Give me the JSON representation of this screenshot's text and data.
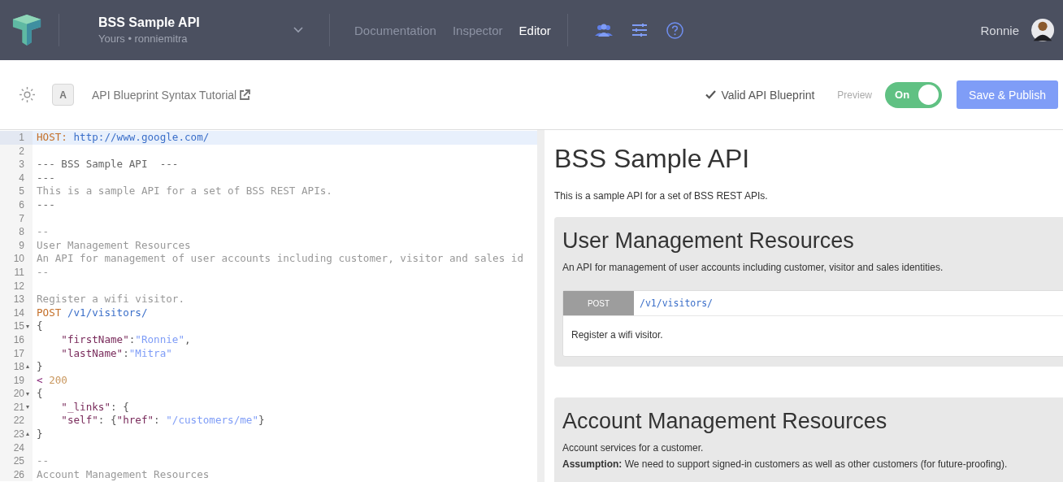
{
  "header": {
    "project_title": "BSS Sample API",
    "project_owner": "Yours • ronniemitra",
    "nav": [
      {
        "label": "Documentation",
        "selected": false
      },
      {
        "label": "Inspector",
        "selected": false
      },
      {
        "label": "Editor",
        "selected": true
      }
    ],
    "user_name": "Ronnie"
  },
  "toolbar": {
    "font_button": "A",
    "tutorial_link": "API Blueprint Syntax Tutorial",
    "validation": "Valid API Blueprint",
    "preview_label": "Preview",
    "preview_toggle": {
      "label": "On",
      "on": true
    },
    "save_button": "Save & Publish"
  },
  "editor": {
    "lines": [
      {
        "number": "1",
        "active": true,
        "tokens": [
          {
            "kind": "keyword",
            "text": "HOST: "
          },
          {
            "kind": "url",
            "text": "http://www.google.com/"
          }
        ]
      },
      {
        "number": "2",
        "active": false
      },
      {
        "number": "3",
        "active": false,
        "tokens": [
          {
            "kind": "heading",
            "text": "--- BSS Sample API  ---"
          }
        ]
      },
      {
        "number": "4",
        "active": false,
        "tokens": [
          {
            "kind": "heading",
            "text": "---"
          }
        ]
      },
      {
        "number": "5",
        "active": false,
        "tokens": [
          {
            "kind": "comment",
            "text": "This is a sample API for a set of BSS REST APIs."
          }
        ]
      },
      {
        "number": "6",
        "active": false,
        "tokens": [
          {
            "kind": "heading",
            "text": "---"
          }
        ]
      },
      {
        "number": "7",
        "active": false
      },
      {
        "number": "8",
        "active": false,
        "tokens": [
          {
            "kind": "comment",
            "text": "--"
          }
        ]
      },
      {
        "number": "9",
        "active": false,
        "tokens": [
          {
            "kind": "comment",
            "text": "User Management Resources"
          }
        ]
      },
      {
        "number": "10",
        "active": false,
        "tokens": [
          {
            "kind": "comment",
            "text": "An API for management of user accounts including customer, visitor and sales id"
          }
        ]
      },
      {
        "number": "11",
        "active": false,
        "tokens": [
          {
            "kind": "comment",
            "text": "--"
          }
        ]
      },
      {
        "number": "12",
        "active": false
      },
      {
        "number": "13",
        "active": false,
        "tokens": [
          {
            "kind": "comment",
            "text": "Register a wifi visitor."
          }
        ]
      },
      {
        "number": "14",
        "active": false,
        "tokens": [
          {
            "kind": "keyword",
            "text": "POST "
          },
          {
            "kind": "url",
            "text": "/v1/visitors/"
          }
        ]
      },
      {
        "number": "15",
        "active": false,
        "fold": "▾",
        "tokens": [
          {
            "kind": "brace",
            "text": "{"
          }
        ]
      },
      {
        "number": "16",
        "active": false,
        "indent": true,
        "tokens": [
          {
            "kind": "key",
            "text": "\"firstName\""
          },
          {
            "kind": "brace",
            "text": ":"
          },
          {
            "kind": "string",
            "text": "\"Ronnie\""
          },
          {
            "kind": "brace",
            "text": ","
          }
        ]
      },
      {
        "number": "17",
        "active": false,
        "indent": true,
        "tokens": [
          {
            "kind": "key",
            "text": "\"lastName\""
          },
          {
            "kind": "brace",
            "text": ":"
          },
          {
            "kind": "string",
            "text": "\"Mitra\""
          }
        ]
      },
      {
        "number": "18",
        "active": false,
        "fold": "▴",
        "tokens": [
          {
            "kind": "brace",
            "text": "}"
          }
        ]
      },
      {
        "number": "19",
        "active": false,
        "tokens": [
          {
            "kind": "marker",
            "text": "< "
          },
          {
            "kind": "number",
            "text": "200"
          }
        ]
      },
      {
        "number": "20",
        "active": false,
        "fold": "▾",
        "tokens": [
          {
            "kind": "brace",
            "text": "{"
          }
        ]
      },
      {
        "number": "21",
        "active": false,
        "fold": "▾",
        "indent": true,
        "tokens": [
          {
            "kind": "key",
            "text": "\"_links\""
          },
          {
            "kind": "brace",
            "text": ": {"
          }
        ]
      },
      {
        "number": "22",
        "active": false,
        "indent": true,
        "tokens": [
          {
            "kind": "key",
            "text": "\"self\""
          },
          {
            "kind": "brace",
            "text": ": {"
          },
          {
            "kind": "key",
            "text": "\"href\""
          },
          {
            "kind": "brace",
            "text": ": "
          },
          {
            "kind": "string",
            "text": "\"/customers/me\""
          },
          {
            "kind": "brace",
            "text": "}"
          }
        ]
      },
      {
        "number": "23",
        "active": false,
        "fold": "▴",
        "tokens": [
          {
            "kind": "brace",
            "text": "}"
          }
        ]
      },
      {
        "number": "24",
        "active": false
      },
      {
        "number": "25",
        "active": false,
        "tokens": [
          {
            "kind": "comment",
            "text": "--"
          }
        ]
      },
      {
        "number": "26",
        "active": false,
        "tokens": [
          {
            "kind": "comment",
            "text": "Account Management Resources"
          }
        ]
      }
    ]
  },
  "preview": {
    "title": "BSS Sample API",
    "description": "This is a sample API for a set of BSS REST APIs.",
    "groups": [
      {
        "title": "User Management Resources",
        "paragraphs": [
          "An API for management of user accounts including customer, visitor and sales identities."
        ],
        "resources": [
          {
            "method": "POST",
            "path": "/v1/visitors/",
            "description": "Register a wifi visitor."
          }
        ]
      },
      {
        "title": "Account Management Resources",
        "paragraphs": [
          "Account services for a customer.",
          "**Assumption:** We need to support signed-in customers as well as other customers (for future-proofing)."
        ]
      }
    ]
  }
}
